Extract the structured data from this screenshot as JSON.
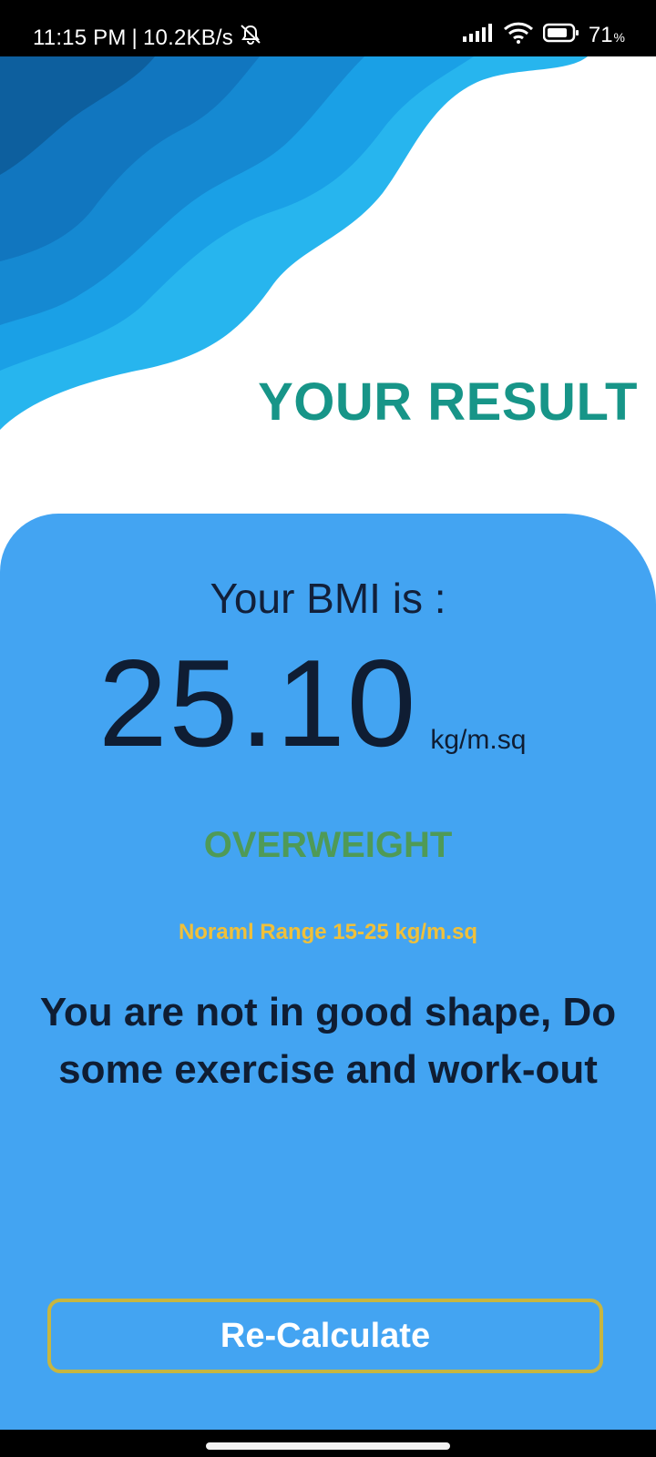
{
  "status_bar": {
    "time": "11:15 PM",
    "separator": "|",
    "speed": "10.2KB/s",
    "battery_percent": "71",
    "battery_percent_sign": "%",
    "icons": [
      "mute-bell-icon",
      "signal-icon",
      "wifi-icon",
      "battery-icon"
    ]
  },
  "header": {
    "title": "YOUR RESULT"
  },
  "result": {
    "label": "Your BMI is  :",
    "value": "25.10",
    "unit": "kg/m.sq",
    "category": "OVERWEIGHT",
    "normal_range": "Noraml Range 15-25 kg/m.sq",
    "advice": "You are not in good shape, Do some exercise and work-out"
  },
  "actions": {
    "recalculate_label": "Re-Calculate"
  },
  "colors": {
    "title": "#179588",
    "card": "#43a4f2",
    "category": "#4f9a57",
    "range": "#f0c03a",
    "button_border": "#c7b640",
    "wave_dark": "#0d5f9e",
    "wave_light": "#27b5ee"
  }
}
